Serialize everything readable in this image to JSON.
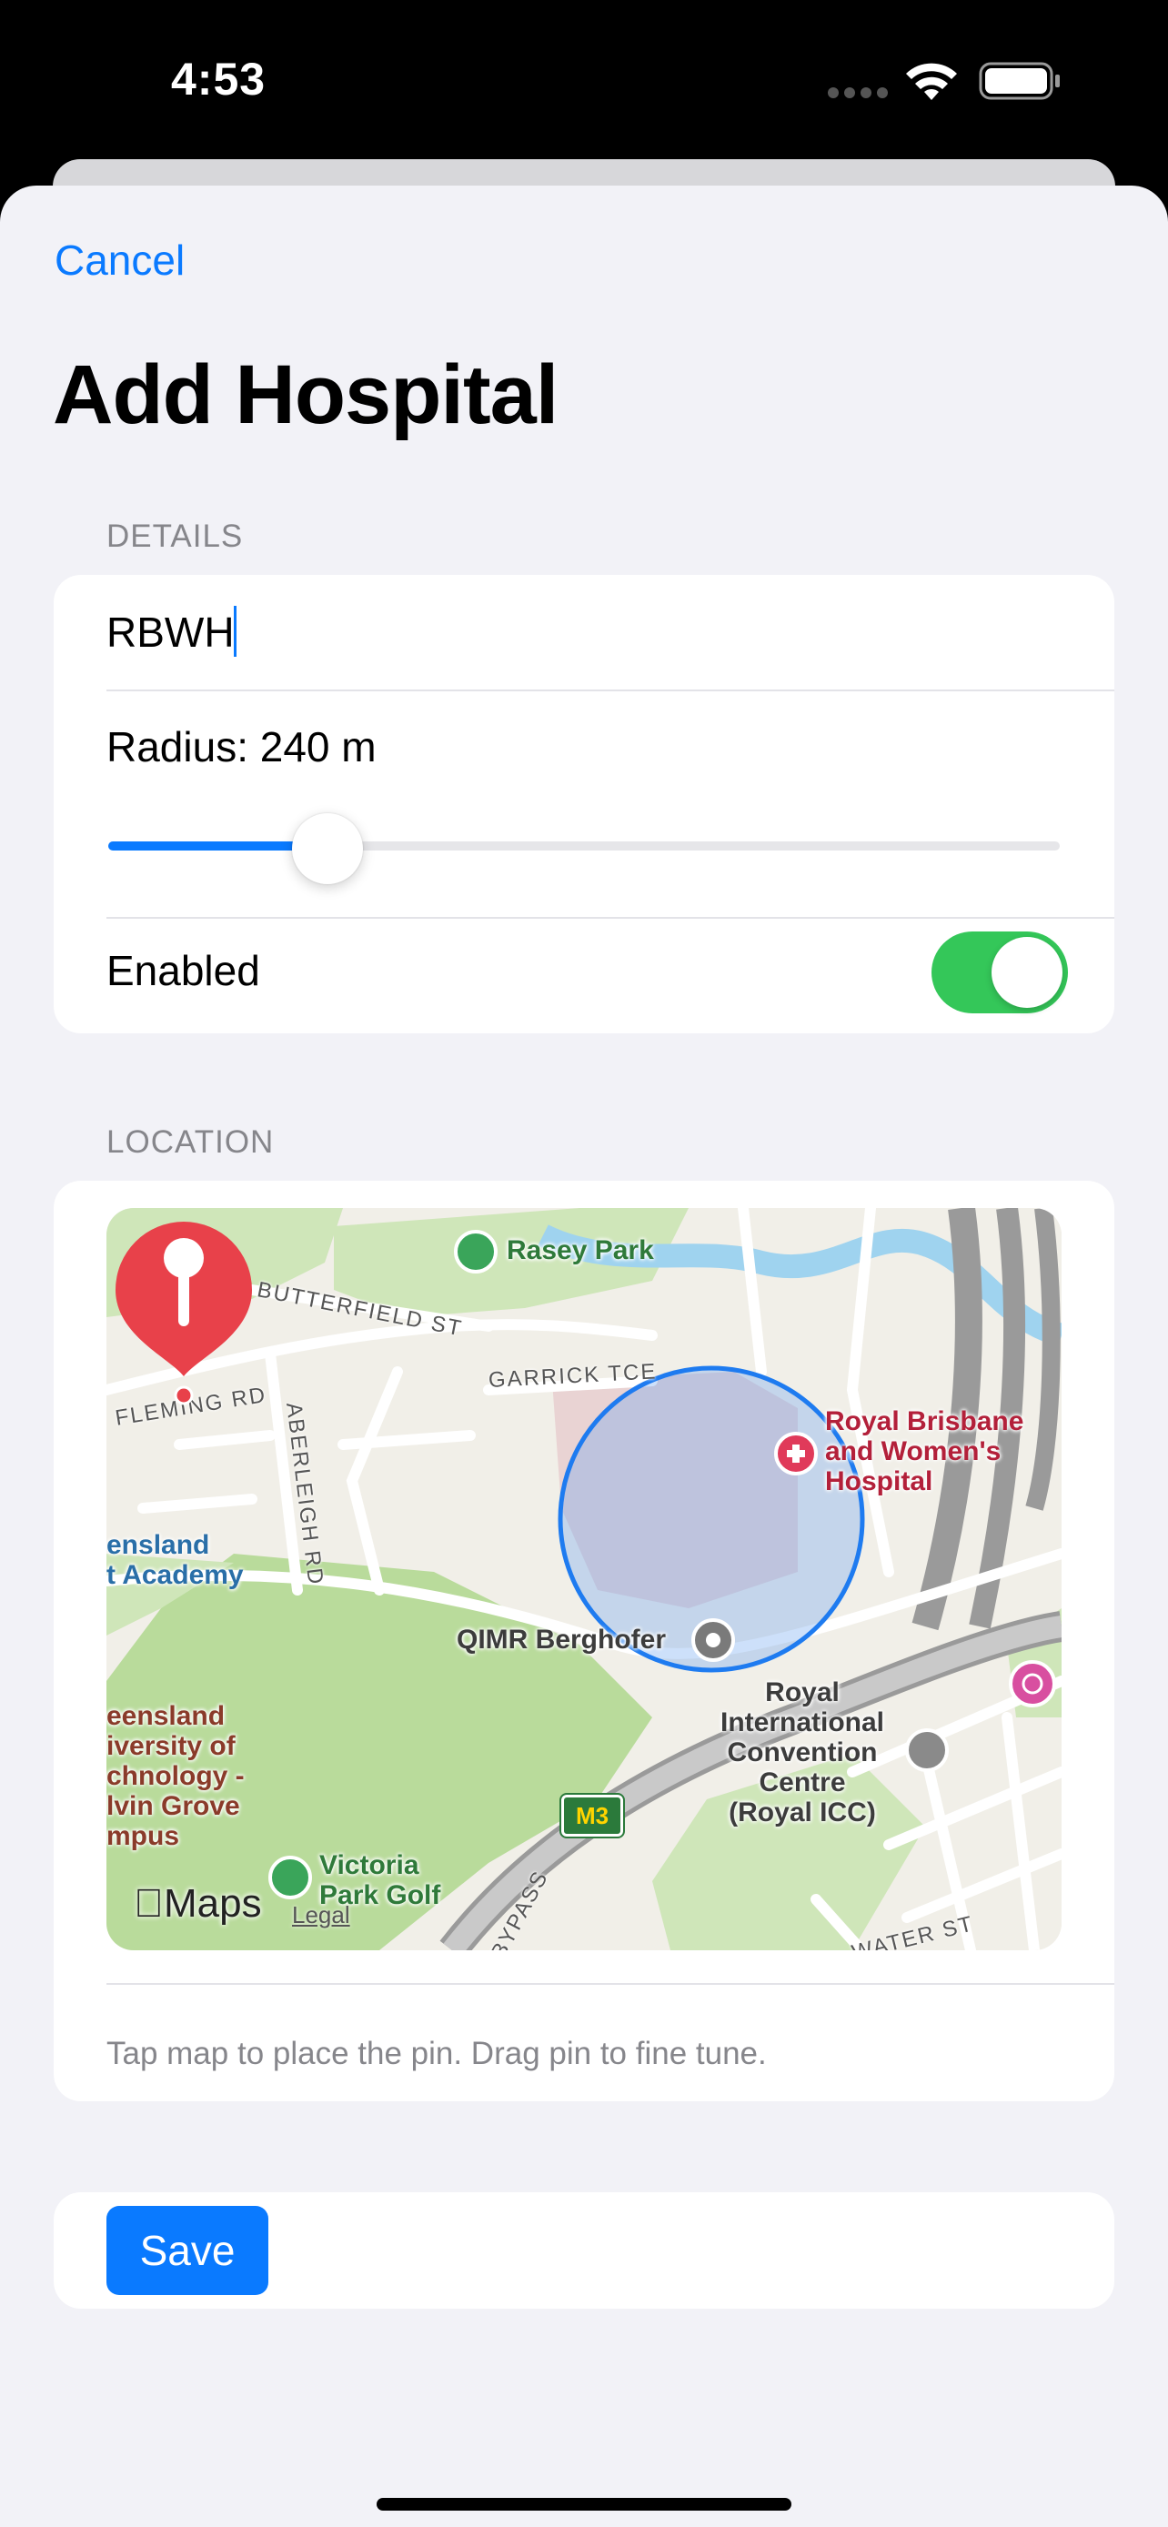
{
  "status_bar": {
    "time": "4:53"
  },
  "nav": {
    "cancel_label": "Cancel",
    "title": "Add Hospital"
  },
  "details": {
    "header": "DETAILS",
    "name_value": "RBWH",
    "radius_label": "Radius: 240 m",
    "radius_slider_fraction": 0.23,
    "enabled_label": "Enabled",
    "enabled": true
  },
  "location": {
    "header": "LOCATION",
    "caption": "Tap map to place the pin. Drag pin to fine tune.",
    "map": {
      "attribution": "Maps",
      "legal_label": "Legal",
      "route_shield": "M3",
      "places": {
        "rasey_park": "Rasey Park",
        "rbwh": "Royal Brisbane\nand Women's\nHospital",
        "qimr": "QIMR Berghofer",
        "qld_academy": "ensland\nt Academy",
        "qut": "eensland\niversity of\nchnology -\nlvin Grove\nmpus",
        "victoria_park": "Victoria\nPark Golf",
        "icc": "Royal\nInternational\nConvention\nCentre\n(Royal ICC)"
      },
      "streets": {
        "butterfield": "BUTTERFIELD ST",
        "fleming": "FLEMING RD",
        "garrick": "GARRICK TCE",
        "aberleigh": "ABERLEIGH RD",
        "bypass": "BYPASS",
        "water": "WATER ST"
      }
    }
  },
  "actions": {
    "save_label": "Save"
  },
  "colors": {
    "accent": "#0a7aff",
    "toggle_on": "#34c759",
    "pin": "#e8414a",
    "geofence": "#1e7bf0"
  }
}
